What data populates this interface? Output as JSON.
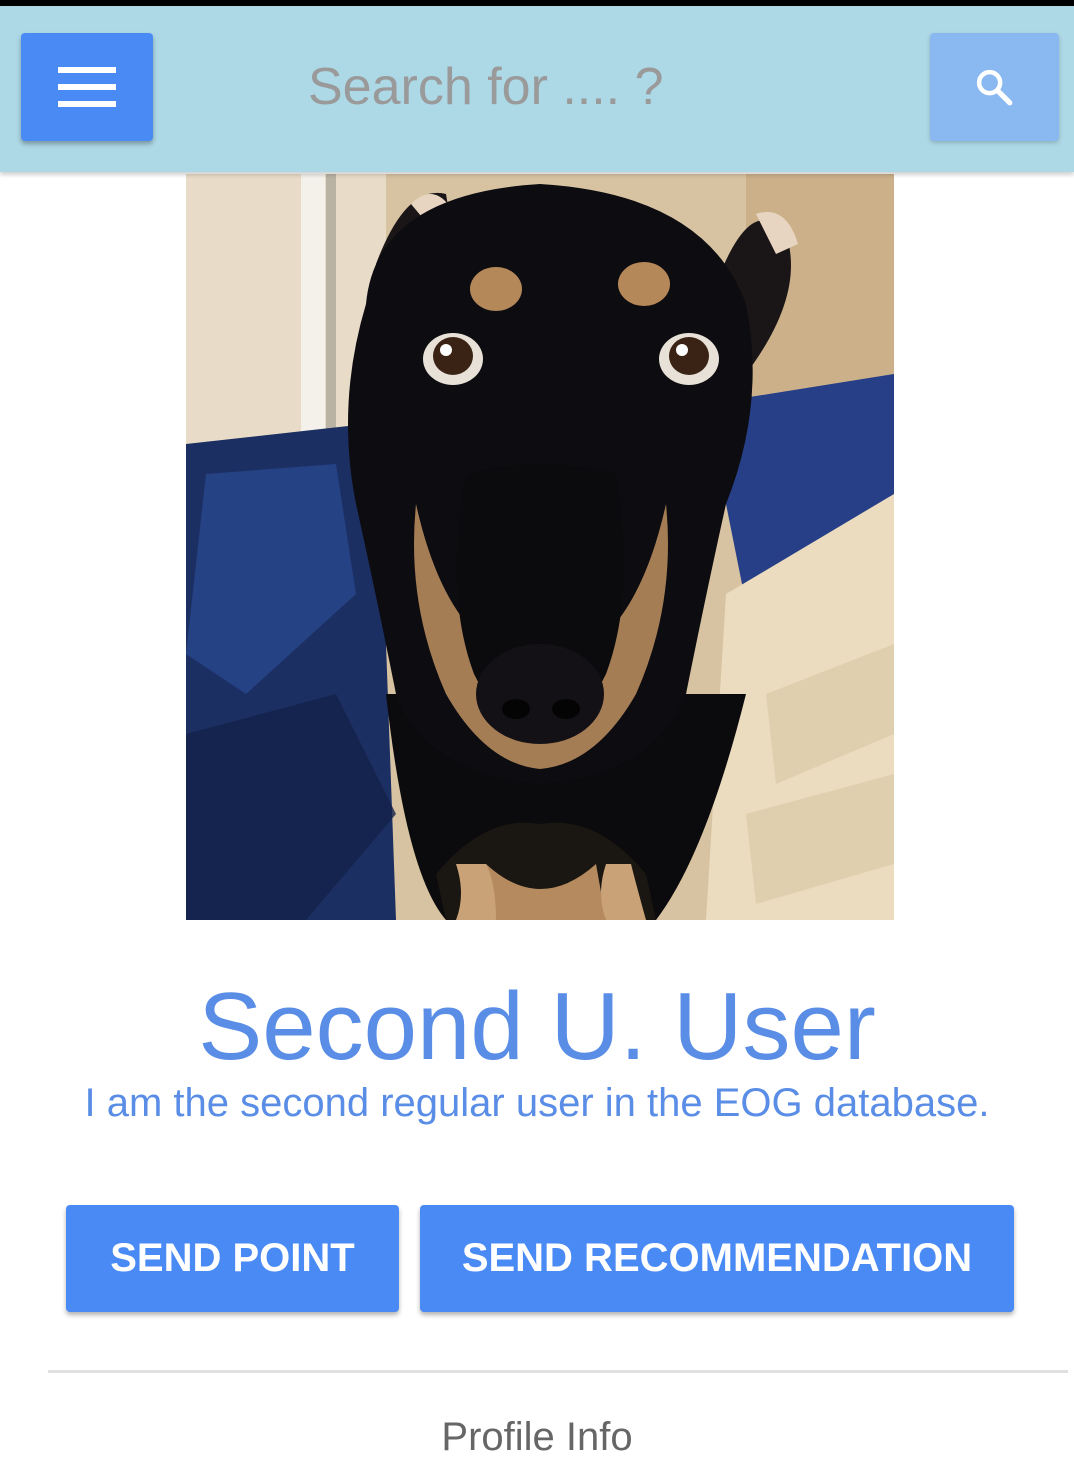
{
  "app_bar": {
    "menu_icon": "hamburger-menu-icon",
    "search": {
      "placeholder": "Search for .... ?",
      "value": ""
    },
    "search_icon": "search-icon",
    "colors": {
      "app_bar_bg": "#add8e6",
      "menu_button_bg": "#4a8af4",
      "search_button_bg": "#8ab8f0"
    }
  },
  "profile": {
    "photo_description": "profile photo of a black and tan dog",
    "name": "Second U. User",
    "bio": "I am the second regular user in the EOG database.",
    "name_color": "#5a8de6"
  },
  "actions": {
    "send_point_label": "SEND POINT",
    "send_recommendation_label": "SEND RECOMMENDATION",
    "button_color": "#4a8af4"
  },
  "sections": {
    "profile_info_title": "Profile Info"
  }
}
